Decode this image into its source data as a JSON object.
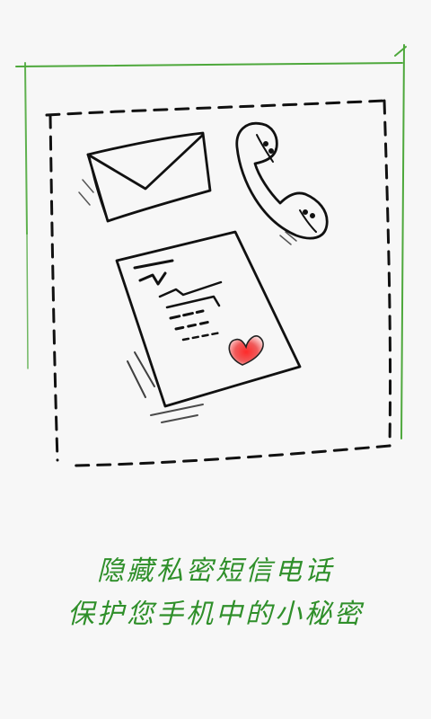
{
  "splash": {
    "tagline_line1": "隐藏私密短信电话",
    "tagline_line2": "保护您手机中的小秘密"
  },
  "illustration": {
    "icons": [
      "envelope-icon",
      "phone-handset-icon",
      "document-icon",
      "heart-icon"
    ],
    "colors": {
      "frame_green": "#4ea83c",
      "sketch_black": "#111111",
      "heart_red": "#e8303a",
      "text_green": "#2f8f2a",
      "background": "#f7f7f7"
    }
  }
}
